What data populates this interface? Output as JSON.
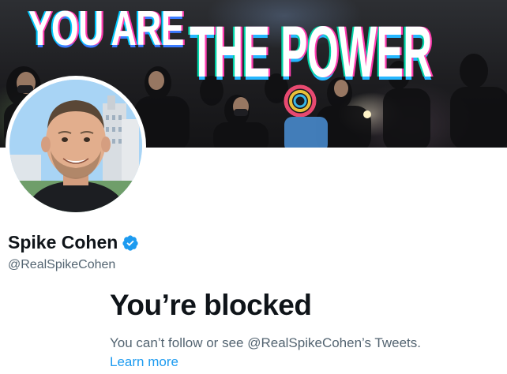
{
  "banner": {
    "text_part1": "YOU ARE",
    "text_part2": "THE POWER"
  },
  "profile": {
    "display_name": "Spike Cohen",
    "handle": "@RealSpikeCohen",
    "verified_icon": "verified-badge-icon"
  },
  "blocked": {
    "title": "You’re blocked",
    "description": "You can’t follow or see @RealSpikeCohen’s Tweets.",
    "learn_more": "Learn more"
  },
  "colors": {
    "link": "#1d9bf0",
    "secondary_text": "#536471",
    "verified": "#1d9bf0"
  }
}
